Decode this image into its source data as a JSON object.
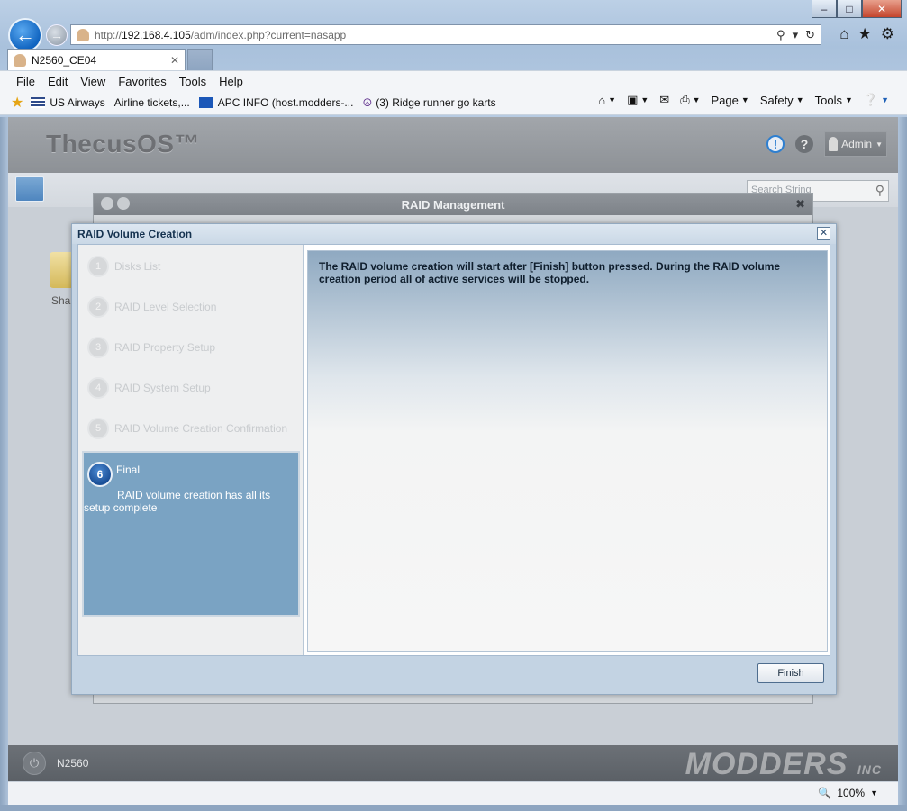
{
  "browser": {
    "address_prefix": "http://",
    "address_host": "192.168.4.105",
    "address_path": "/adm/index.php?current=nasapp",
    "tab_title": "N2560_CE04",
    "menu": [
      "File",
      "Edit",
      "View",
      "Favorites",
      "Tools",
      "Help"
    ],
    "favorites": [
      "US Airways",
      "Airline tickets,...",
      "APC INFO (host.modders-...",
      "(3) Ridge runner go karts"
    ],
    "commands": [
      "Page",
      "Safety",
      "Tools"
    ],
    "zoom": "100%"
  },
  "app": {
    "brand": "ThecusOS™",
    "user": "Admin",
    "search_placeholder": "Search String",
    "desktop_label": "Sha",
    "device_name": "N2560",
    "watermark": "MODDERS",
    "watermark_small": "INC"
  },
  "raid_management": {
    "title": "RAID Management"
  },
  "wizard": {
    "title": "RAID Volume Creation",
    "steps": [
      {
        "num": "1",
        "label": "Disks List"
      },
      {
        "num": "2",
        "label": "RAID Level Selection"
      },
      {
        "num": "3",
        "label": "RAID Property Setup"
      },
      {
        "num": "4",
        "label": "RAID System Setup"
      },
      {
        "num": "5",
        "label": "RAID Volume Creation Confirmation"
      }
    ],
    "active_step": {
      "num": "6",
      "label": "Final",
      "description": "RAID volume creation has all its setup complete"
    },
    "message": "The RAID volume creation will start after [Finish] button pressed. During the RAID volume creation period all of active services will be stopped.",
    "finish_label": "Finish"
  },
  "icons": {
    "back": "back-arrow-icon",
    "forward": "forward-arrow-icon",
    "home": "home-icon",
    "favorites": "star-icon",
    "settings": "gear-icon"
  },
  "colors": {
    "active_step_bg": "#7aa3c3",
    "info_blue": "#2e7fd0"
  }
}
